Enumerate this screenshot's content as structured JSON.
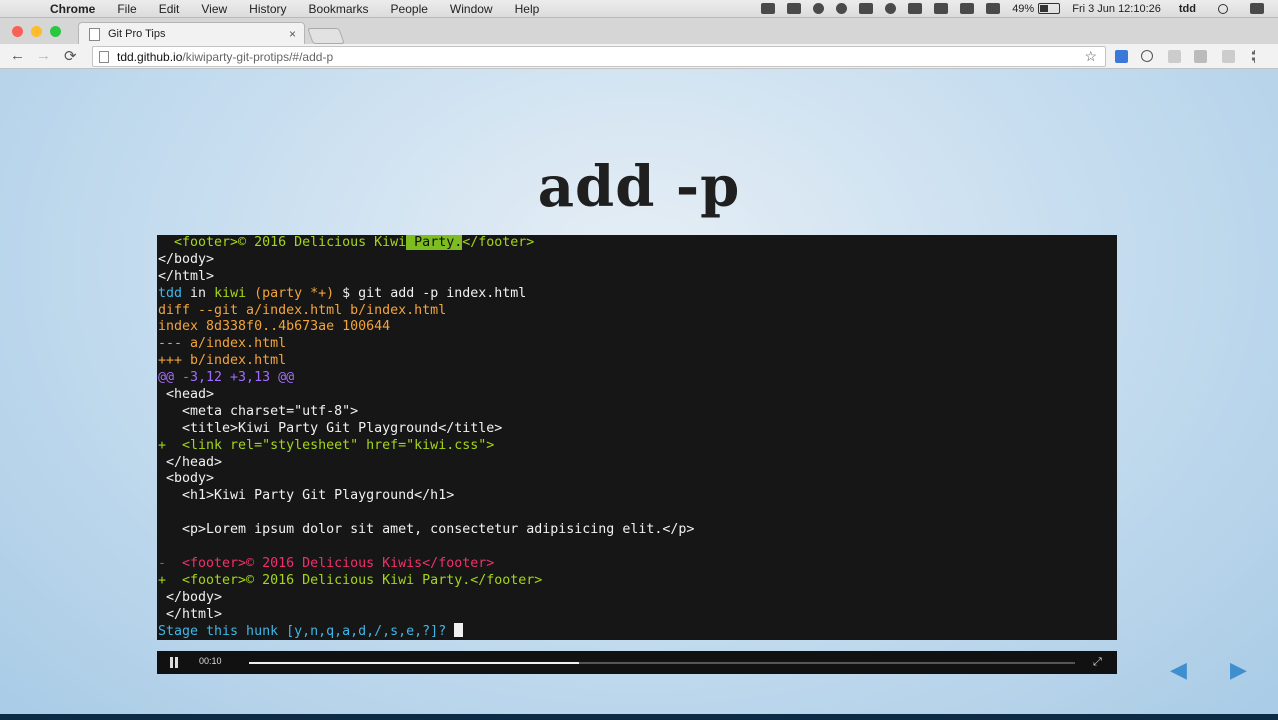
{
  "menubar": {
    "apple": "",
    "app_name": "Chrome",
    "menus": [
      "File",
      "Edit",
      "View",
      "History",
      "Bookmarks",
      "People",
      "Window",
      "Help"
    ],
    "battery": "49%",
    "datetime": "Fri 3 Jun  12:10:26",
    "user": "tdd"
  },
  "tabs": [
    {
      "title": "Git Pro Tips",
      "close": "×"
    }
  ],
  "toolbar": {
    "back": "←",
    "forward": "→",
    "reload": "⟳",
    "url_host": "tdd.github.io",
    "url_path": "/kiwiparty-git-protips/#/add-p",
    "star": "☆"
  },
  "slide": {
    "title": "add -p"
  },
  "terminal": {
    "lines": [
      [
        {
          "t": "  <footer>© 2016 Delicious Kiwi",
          "c": "green"
        },
        {
          "t": " Party.",
          "c": "hl"
        },
        {
          "t": "</footer>",
          "c": "green"
        }
      ],
      [
        {
          "t": "</body>",
          "c": "white"
        }
      ],
      [
        {
          "t": "</html>",
          "c": "white"
        }
      ],
      [
        {
          "t": "tdd ",
          "c": "cyan"
        },
        {
          "t": "in ",
          "c": "white"
        },
        {
          "t": "kiwi ",
          "c": "green"
        },
        {
          "t": "(party *+) ",
          "c": "orange"
        },
        {
          "t": "$ git add -p index.html",
          "c": "white"
        }
      ],
      [
        {
          "t": "diff --git a/index.html b/index.html",
          "c": "orange"
        }
      ],
      [
        {
          "t": "index 8d338f0..4b673ae 100644",
          "c": "orange"
        }
      ],
      [
        {
          "t": "--- a/index.html",
          "c": "orange"
        }
      ],
      [
        {
          "t": "+++ b/index.html",
          "c": "orange"
        }
      ],
      [
        {
          "t": "@@ -3,12 +3,13 @@",
          "c": "purple"
        }
      ],
      [
        {
          "t": " <head>",
          "c": "white"
        }
      ],
      [
        {
          "t": "   <meta charset=\"utf-8\">",
          "c": "white"
        }
      ],
      [
        {
          "t": "   <title>Kiwi Party Git Playground</title>",
          "c": "white"
        }
      ],
      [
        {
          "t": "+  <link rel=\"stylesheet\" href=\"kiwi.css\">",
          "c": "green"
        }
      ],
      [
        {
          "t": " </head>",
          "c": "white"
        }
      ],
      [
        {
          "t": " <body>",
          "c": "white"
        }
      ],
      [
        {
          "t": "   <h1>Kiwi Party Git Playground</h1>",
          "c": "white"
        }
      ],
      [
        {
          "t": "",
          "c": "white"
        }
      ],
      [
        {
          "t": "   <p>Lorem ipsum dolor sit amet, consectetur adipisicing elit.</p>",
          "c": "white"
        }
      ],
      [
        {
          "t": "",
          "c": "white"
        }
      ],
      [
        {
          "t": "-  <footer>© 2016 Delicious Kiwis</footer>",
          "c": "red"
        }
      ],
      [
        {
          "t": "+  <footer>© 2016 Delicious Kiwi Party.</footer>",
          "c": "green"
        }
      ],
      [
        {
          "t": " </body>",
          "c": "white"
        }
      ],
      [
        {
          "t": " </html>",
          "c": "white"
        }
      ],
      [
        {
          "t": "Stage this hunk [y,n,q,a,d,/,s,e,?]? ",
          "c": "cyan"
        },
        {
          "t": "",
          "c": "cursor"
        }
      ]
    ]
  },
  "player": {
    "time": "00:10",
    "progress": 0.4,
    "fullscreen": "⤢"
  },
  "nav_arrows": {
    "prev": "◀",
    "next": "▶"
  },
  "colors": {
    "terminal_bg": "#161616",
    "green": "#a4d41c",
    "cyan": "#3fb6e6",
    "orange": "#f3a33c",
    "purple": "#a36bff",
    "red": "#f0306b",
    "arrow": "#3d8fd0"
  }
}
